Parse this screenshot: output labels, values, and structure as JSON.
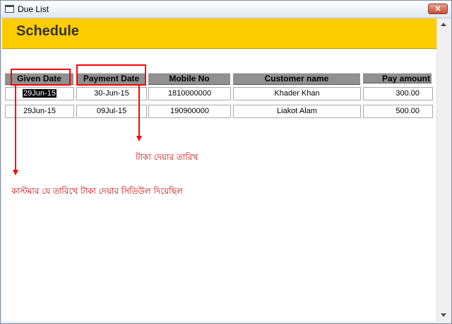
{
  "window": {
    "title": "Due List",
    "close_label": "✕"
  },
  "header": {
    "title": "Schedule"
  },
  "table": {
    "columns": [
      "Given Date",
      "Payment Date",
      "Mobile No",
      "Customer name",
      "Pay amount"
    ],
    "rows": [
      {
        "given_date": "29Jun-15",
        "payment_date": "30-Jun-15",
        "mobile_no": "1810000000",
        "customer_name": "Khader Khan",
        "pay_amount": "300.00"
      },
      {
        "given_date": "29Jun-15",
        "payment_date": "09Jul-15",
        "mobile_no": "190900000",
        "customer_name": "Liakot Alam",
        "pay_amount": "500.00"
      }
    ]
  },
  "annotations": {
    "payment_date_note": "টাকা দেয়ার তারিখ",
    "given_date_note": "কাস্টমার যে তারিখে টাকা দেয়ার সিডিউল দিয়েছিল",
    "color": "#ff0000"
  },
  "colors": {
    "header_bg": "#ffcc00",
    "column_header_bg": "#909090"
  }
}
